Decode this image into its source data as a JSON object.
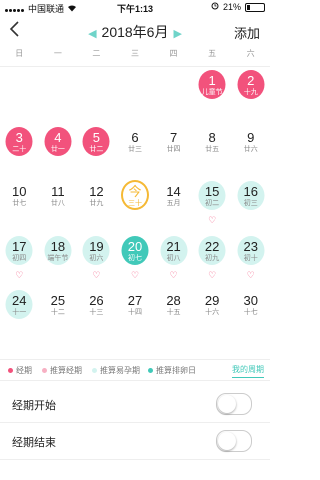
{
  "status_bar": {
    "carrier": "中国联通",
    "time": "下午1:13",
    "battery": "21%",
    "battery_level": 0.21
  },
  "header": {
    "back_icon": "chevron-left-icon",
    "title": "2018年6月",
    "add_label": "添加"
  },
  "weekdays": [
    "日",
    "一",
    "二",
    "三",
    "四",
    "五",
    "六"
  ],
  "colors": {
    "period": "#f2527c",
    "safe": "#d3f3ef",
    "ovulation": "#41c9b9",
    "today": "#f5b935",
    "accent": "#41c9b9"
  },
  "days": [
    {
      "day": "1",
      "lunar": "儿童节",
      "type": "period"
    },
    {
      "day": "2",
      "lunar": "十九",
      "type": "period"
    },
    {
      "day": "3",
      "lunar": "二十",
      "type": "period"
    },
    {
      "day": "4",
      "lunar": "廿一",
      "type": "period"
    },
    {
      "day": "5",
      "lunar": "廿二",
      "type": "period"
    },
    {
      "day": "6",
      "lunar": "廿三",
      "type": "normal"
    },
    {
      "day": "7",
      "lunar": "廿四",
      "type": "normal"
    },
    {
      "day": "8",
      "lunar": "廿五",
      "type": "normal"
    },
    {
      "day": "9",
      "lunar": "廿六",
      "type": "normal"
    },
    {
      "day": "10",
      "lunar": "廿七",
      "type": "normal"
    },
    {
      "day": "11",
      "lunar": "廿八",
      "type": "normal"
    },
    {
      "day": "12",
      "lunar": "廿九",
      "type": "normal"
    },
    {
      "day": "今",
      "lunar": "三十",
      "type": "today"
    },
    {
      "day": "14",
      "lunar": "五月",
      "type": "normal"
    },
    {
      "day": "15",
      "lunar": "初二",
      "type": "safe",
      "heart": true
    },
    {
      "day": "16",
      "lunar": "初三",
      "type": "safe"
    },
    {
      "day": "17",
      "lunar": "初四",
      "type": "safe",
      "heart": true
    },
    {
      "day": "18",
      "lunar": "端午节",
      "type": "safe"
    },
    {
      "day": "19",
      "lunar": "初六",
      "type": "safe",
      "heart": true
    },
    {
      "day": "20",
      "lunar": "初七",
      "type": "ovulation",
      "heart": true
    },
    {
      "day": "21",
      "lunar": "初八",
      "type": "safe",
      "heart": true
    },
    {
      "day": "22",
      "lunar": "初九",
      "type": "safe",
      "heart": true
    },
    {
      "day": "23",
      "lunar": "初十",
      "type": "safe",
      "heart": true
    },
    {
      "day": "24",
      "lunar": "十一",
      "type": "safe"
    },
    {
      "day": "25",
      "lunar": "十二",
      "type": "normal"
    },
    {
      "day": "26",
      "lunar": "十三",
      "type": "normal"
    },
    {
      "day": "27",
      "lunar": "十四",
      "type": "normal"
    },
    {
      "day": "28",
      "lunar": "十五",
      "type": "normal"
    },
    {
      "day": "29",
      "lunar": "十六",
      "type": "normal"
    },
    {
      "day": "30",
      "lunar": "十七",
      "type": "normal"
    }
  ],
  "legend": [
    {
      "label": "经期",
      "color": "#f2527c"
    },
    {
      "label": "推算经期",
      "color": "#f7b0c3"
    },
    {
      "label": "推算易孕期",
      "color": "#d3f3ef"
    },
    {
      "label": "推算排卵日",
      "color": "#41c9b9"
    }
  ],
  "my_cycle_label": "我的周期",
  "settings": [
    {
      "label": "经期开始",
      "on": false
    },
    {
      "label": "经期结束",
      "on": false
    }
  ]
}
